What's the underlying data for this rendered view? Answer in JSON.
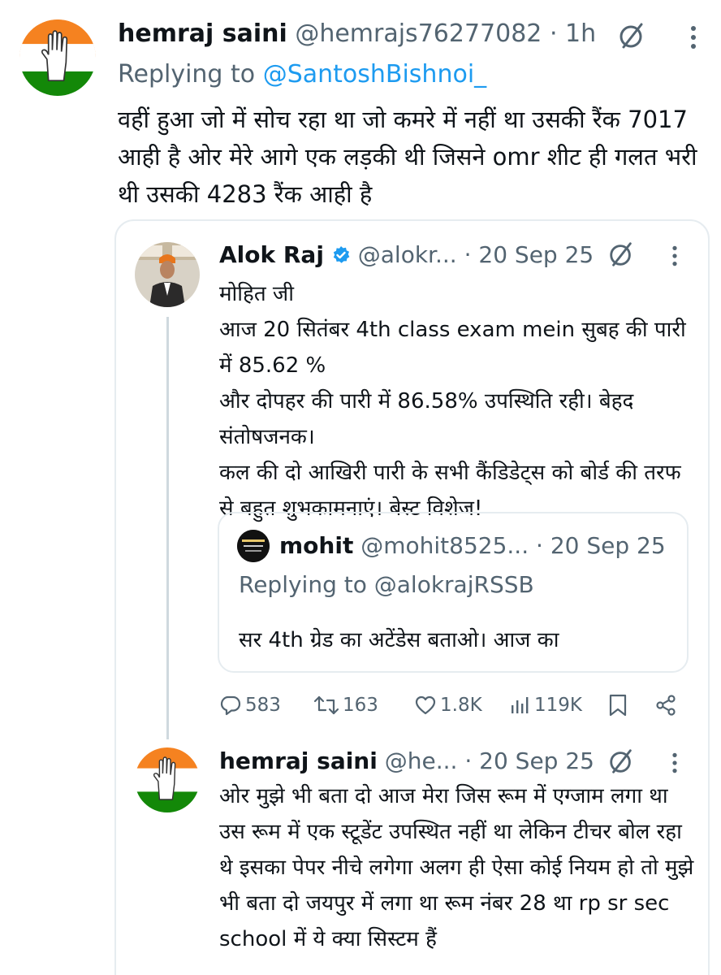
{
  "main_tweet": {
    "name": "hemraj saini",
    "handle": "@hemrajs76277082",
    "time": "· 1h",
    "replying_prefix": "Replying to",
    "replying_to": "@SantoshBishnoi_",
    "text": "वहीं हुआ जो में सोच रहा था जो कमरे में नहीं था उसकी रैंक 7017 आही है ओर मेरे आगे एक लड़की थी जिसने omr शीट ही गलत भरी थी उसकी 4283 रैंक आही है"
  },
  "quoted_tweet": {
    "name": "Alok Raj",
    "handle": "@alokr...",
    "time": "· 20 Sep 25",
    "lines": [
      "मोहित जी",
      "आज 20 सितंबर 4th class exam mein सुबह की पारी में 85.62 %",
      "और दोपहर की पारी में 86.58% उपस्थिति रही। बेहद संतोषजनक।",
      "कल की दो आखिरी पारी के सभी कैंडिडेट्स को बोर्ड की तरफ से बहुत शुभकामनाएं। बेस्ट विशेज!"
    ]
  },
  "nested_quote": {
    "name": "mohit",
    "handle": "@mohit8525...",
    "time": "· 20 Sep 25",
    "replying_prefix": "Replying to",
    "replying_to": "@alokrajRSSB",
    "text": "सर 4th ग्रेड का अटेंडेस बताओ। आज का"
  },
  "actions": {
    "replies": "583",
    "reposts": "163",
    "likes": "1.8K",
    "views": "119K"
  },
  "reply_tweet": {
    "name": "hemraj saini",
    "handle": "@he...",
    "time": "· 20 Sep 25",
    "text": "ओर मुझे भी बता दो आज मेरा जिस रूम में एग्जाम लगा था उस रूम में एक स्टूडेंट उपस्थित नहीं था लेकिन टीचर बोल रहा थे इसका पेपर नीचे लगेगा अलग ही ऐसा कोई नियम हो तो मुझे भी बता दो जयपुर में लगा था रूम नंबर 28 था rp sr sec school में ये क्या सिस्टम हैं"
  },
  "icons": {
    "grok": "grok-slash-circle-icon",
    "more": "more-vertical-icon",
    "reply": "comment-icon",
    "repost": "repost-icon",
    "like": "heart-icon",
    "views": "views-bar-icon",
    "bookmark": "bookmark-icon",
    "share": "share-icon",
    "verified": "verified-badge-icon"
  },
  "colors": {
    "link": "#1d9bf0",
    "muted": "#536471",
    "verified": "#1d9bf0",
    "congress_saffron": "#f58220",
    "congress_green": "#138808"
  }
}
